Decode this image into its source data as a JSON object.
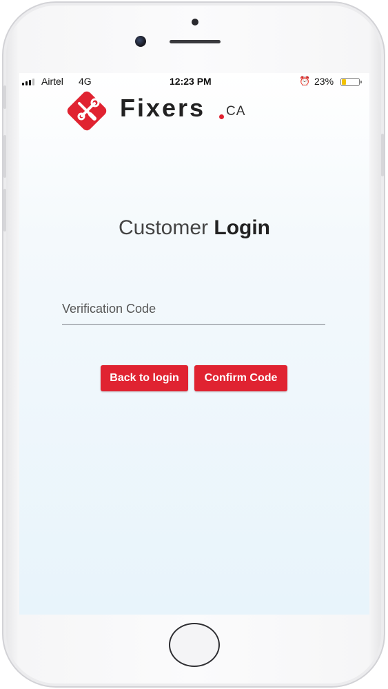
{
  "status_bar": {
    "carrier": "Airtel",
    "network": "4G",
    "time": "12:23 PM",
    "battery_percent": "23%",
    "battery_level": 0.23
  },
  "logo": {
    "wordmark": "Fixers",
    "tld": "CA",
    "brand_color": "#e02331"
  },
  "login": {
    "title_light": "Customer",
    "title_bold": "Login"
  },
  "form": {
    "verification_placeholder": "Verification Code",
    "verification_value": ""
  },
  "buttons": {
    "back_label": "Back to login",
    "confirm_label": "Confirm Code"
  },
  "icons": [
    "alarm-icon",
    "signal-icon",
    "battery-icon",
    "fixers-logo-icon"
  ]
}
